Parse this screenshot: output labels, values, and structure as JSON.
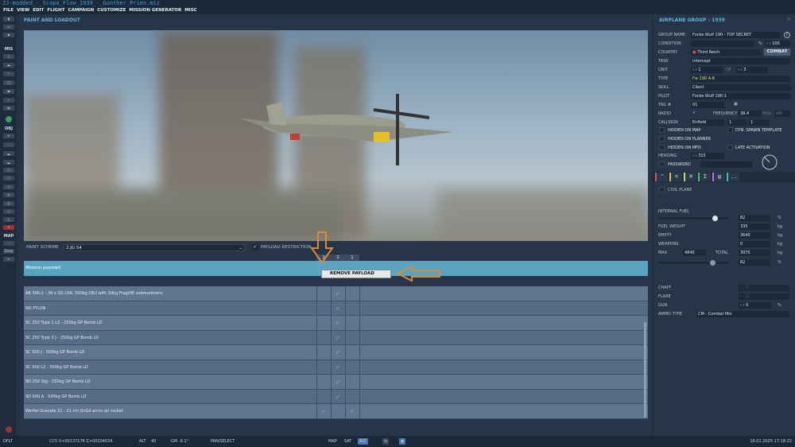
{
  "title": "JJ-modded_-_Scapa_Flow_1939_-_Gunther_Prien.miz",
  "menu": [
    "FILE",
    "VIEW",
    "EDIT",
    "FLIGHT",
    "CAMPAIGN",
    "CUSTOMIZE",
    "MISSION GENERATOR",
    "MISC"
  ],
  "toolbar": {
    "mis": "MIS",
    "obj": "OBJ",
    "map": "MAP",
    "draw": "Draw"
  },
  "main": {
    "title": "PAINT AND LOADOUT",
    "paint_scheme_label": "PAINT SCHEME",
    "paint_scheme": "2.JG 54",
    "payload_restriction": "PAYLOAD RESTRICTION",
    "columns": [
      "3",
      "2",
      "1"
    ],
    "mission_payload": "Mission payload",
    "context_menu": "REMOVE PAYLOAD",
    "payloads": [
      {
        "name": "AB 500-1 - 34 x SD-10A, 500kg CBU with 10kg Frag/HE submunitions",
        "checks": [
          false,
          true,
          false
        ]
      },
      {
        "name": "NO PYLON",
        "checks": [
          false,
          true,
          false
        ]
      },
      {
        "name": "SC 250 Type 1 L2 - 250kg GP Bomb LD",
        "checks": [
          false,
          true,
          false
        ]
      },
      {
        "name": "SC 250 Type 3 J - 250kg GP Bomb LD",
        "checks": [
          false,
          true,
          false
        ]
      },
      {
        "name": "SC 500 J - 500kg GP Bomb LD",
        "checks": [
          false,
          true,
          false
        ]
      },
      {
        "name": "SC 500 L2 - 500kg GP Bomb LD",
        "checks": [
          false,
          true,
          false
        ]
      },
      {
        "name": "SD 250 Stg - 250kg GP Bomb LD",
        "checks": [
          false,
          true,
          false
        ]
      },
      {
        "name": "SD 500 A - 500kg GP Bomb LD",
        "checks": [
          false,
          true,
          false
        ]
      },
      {
        "name": "Werfer-Granate 21 - 21 cm UnGd air-to-air rocket",
        "checks": [
          true,
          false,
          true
        ]
      }
    ],
    "check_glyph": "✓"
  },
  "right": {
    "title": "AIRPLANE GROUP - 1939",
    "group_name_label": "GROUP NAME",
    "group_name": "Focke Wulf 190 - TOP SECRET",
    "condition_label": "CONDITION",
    "condition": "100",
    "pct": "%",
    "country_label": "COUNTRY",
    "country": "Third Reich",
    "combat": "COMBAT",
    "task_label": "TASK",
    "task": "Intercept",
    "unit_label": "UNIT",
    "unit": "1",
    "of": "OF",
    "unit_of": "3",
    "type_label": "TYPE",
    "type": "Fw 190 A-8",
    "skill_label": "SKILL",
    "skill": "Client",
    "pilot_label": "PILOT",
    "pilot": "Focke Wulf 190-1",
    "tail_label": "TAIL #",
    "tail": "01",
    "radio_label": "RADIO",
    "frequency_label": "FREQUENCY",
    "frequency": "38.4",
    "mhz": "MHz",
    "am": "AM",
    "callsign_label": "CALLSIGN",
    "callsign": "Enfield",
    "callsign_n1": "1",
    "callsign_n2": "1",
    "hidden_map": "HIDDEN ON MAP",
    "dyn_spawn": "DYN. SPAWN TEMPLATE",
    "hidden_planner": "HIDDEN ON PLANNER",
    "hidden_mfd": "HIDDEN ON MFD",
    "late_activation": "LATE ACTIVATION",
    "heading_label": "HEADING",
    "heading": "315",
    "password": "PASSWORD",
    "civil_plane": "CIVIL PLANE",
    "internal_fuel_label": "INTERNAL FUEL",
    "internal_fuel": "82",
    "internal_fuel_fraction": 0.82,
    "fuel_weight_label": "FUEL WEIGHT",
    "fuel_weight": "335",
    "empty_label": "EMPTY",
    "empty": "3640",
    "weapons_label": "WEAPONS",
    "weapons": "0",
    "max_label": "MAX",
    "max": "4840",
    "total_label": "TOTAL",
    "total": "3975",
    "total_pct": "82",
    "kg": "kg",
    "chaff_label": "CHAFF",
    "flare_label": "FLARE",
    "gun_label": "GUN",
    "gun": "0",
    "ammo_label": "AMMO TYPE",
    "ammo": "CM - Combat Mix",
    "tab_colors": [
      "#e05060",
      "#e0c050",
      "#c0e060",
      "#50c070",
      "#c070e0",
      "#40c0c0"
    ]
  },
  "status": {
    "layer": "DFLT",
    "coords": "CCS  X+00137176 Z+00204024",
    "alt_label": "ALT",
    "alt": "40",
    "gm": "GM -9.1°",
    "mode": "PAN/SELECT",
    "map": "MAP",
    "sat": "SAT",
    "alt_btn": "ALT",
    "datetime": "16.01.2025 17:18:23"
  }
}
